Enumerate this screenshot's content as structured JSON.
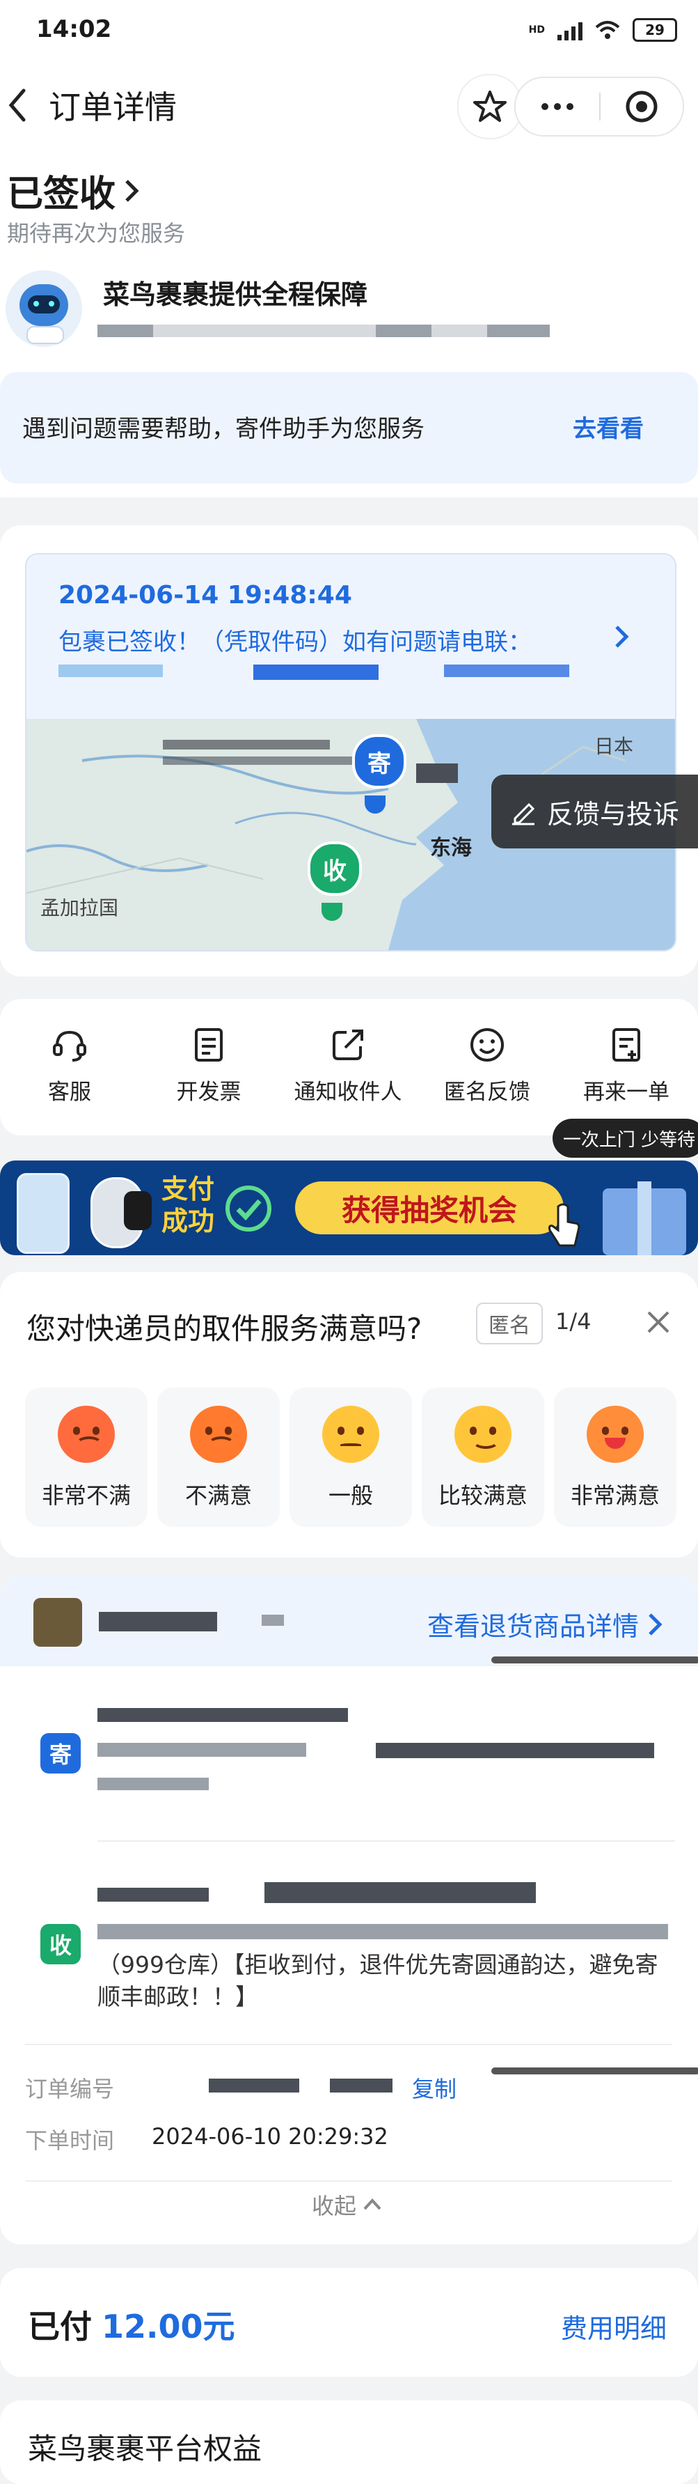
{
  "status_bar": {
    "time": "14:02",
    "network": "HD",
    "battery": "29"
  },
  "nav": {
    "title": "订单详情"
  },
  "order_status": {
    "title": "已签收",
    "subtitle": "期待再次为您服务"
  },
  "assurance": {
    "title": "菜鸟裹裹提供全程保障"
  },
  "help": {
    "text": "遇到问题需要帮助，寄件助手为您服务",
    "link": "去看看"
  },
  "tracking": {
    "datetime": "2024-06-14 19:48:44",
    "message": "包裹已签收！（凭取件码）如有问题请电联：",
    "map_labels": {
      "japan": "日本",
      "east_sea": "东海",
      "bangladesh": "孟加拉国"
    },
    "sender_pin": "寄",
    "receiver_pin": "收",
    "feedback": "反馈与投诉"
  },
  "actions": [
    {
      "label": "客服",
      "icon": "headset-icon"
    },
    {
      "label": "开发票",
      "icon": "invoice-icon"
    },
    {
      "label": "通知收件人",
      "icon": "share-icon"
    },
    {
      "label": "匿名反馈",
      "icon": "smile-icon"
    },
    {
      "label": "再来一单",
      "icon": "reorder-icon"
    }
  ],
  "tooltip": "一次上门 少等待",
  "banner": {
    "line1": "支付",
    "line2": "成功",
    "cta": "获得抽奖机会"
  },
  "survey": {
    "question": "您对快递员的取件服务满意吗?",
    "anon": "匿名",
    "page": "1/4",
    "options": [
      "非常不满",
      "不满意",
      "一般",
      "比较满意",
      "非常满意"
    ]
  },
  "return": {
    "link": "查看退货商品详情"
  },
  "sender": {
    "tag": "寄"
  },
  "receiver": {
    "tag": "收",
    "note": "（999仓库）【拒收到付，退件优先寄圆通韵达，避免寄顺丰邮政！！】"
  },
  "order": {
    "number_label": "订单编号",
    "copy": "复制",
    "time_label": "下单时间",
    "time_value": "2024-06-10 20:29:32",
    "collapse": "收起"
  },
  "payment": {
    "prefix": "已付",
    "amount": "12.00元",
    "detail": "费用明细"
  },
  "benefits": {
    "title": "菜鸟裹裹平台权益"
  },
  "colors": {
    "accent": "#1f6bde",
    "green": "#1aaa6b",
    "banner": "#0b3f86"
  }
}
